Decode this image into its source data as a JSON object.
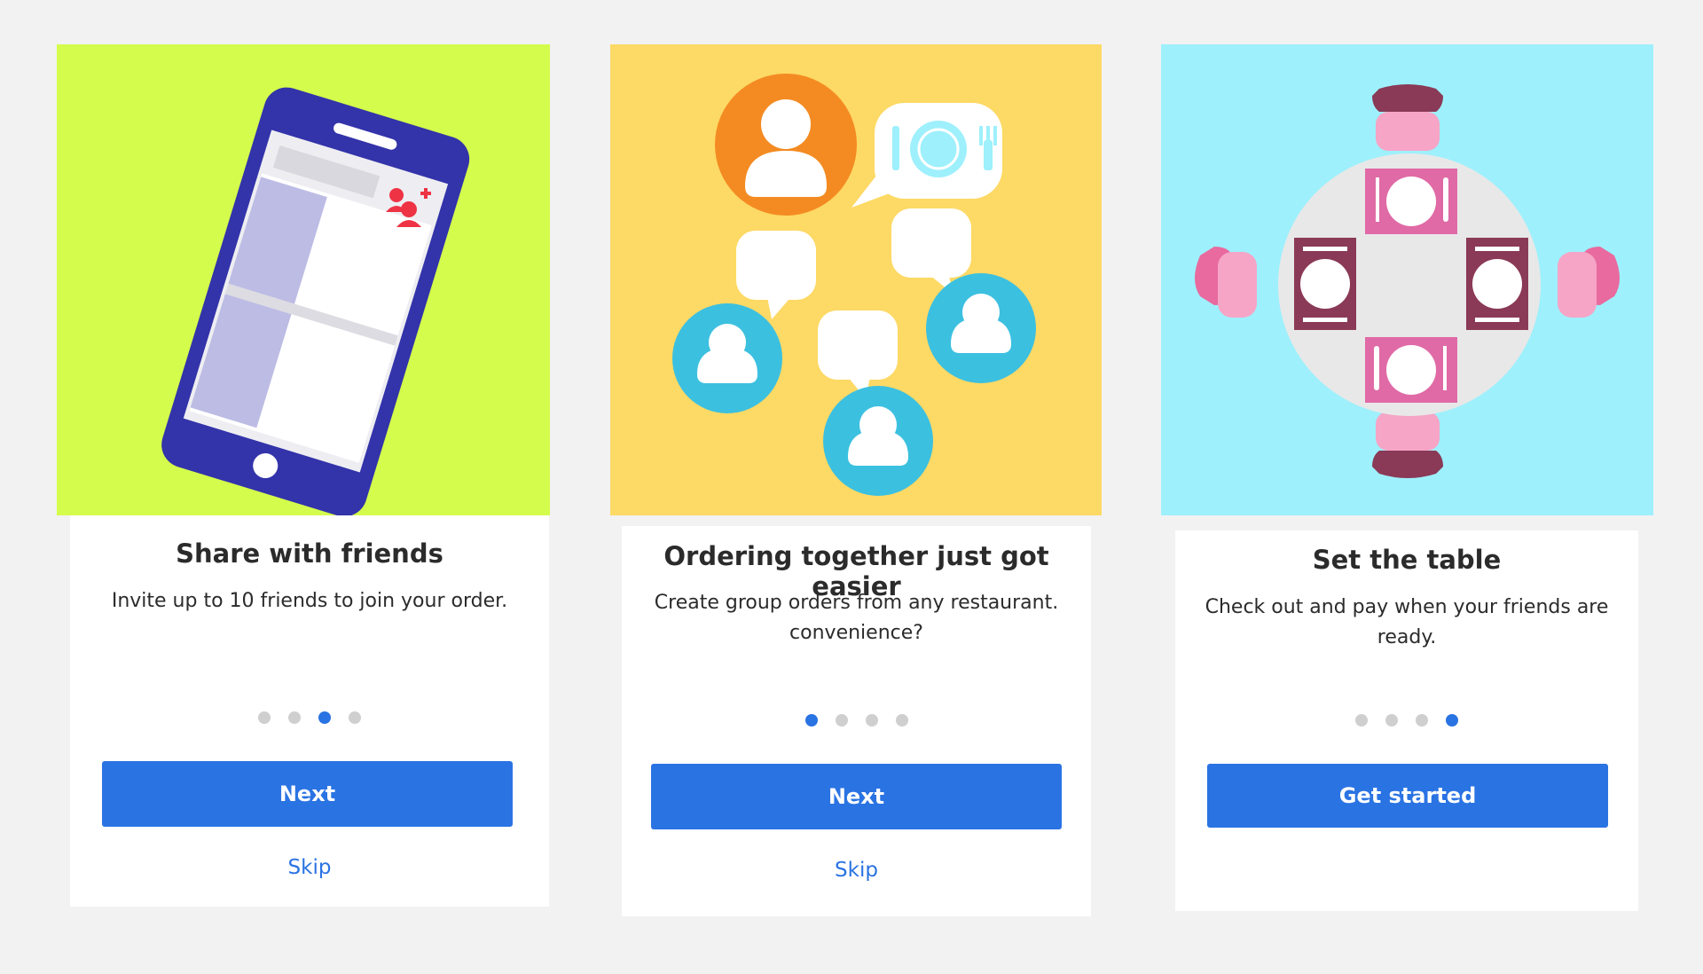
{
  "colors": {
    "page_bg": "#f2f2f2",
    "primary": "#2a73e3",
    "dot_inactive": "#cfcfcf",
    "panel_1_bg": "#d4fc4c",
    "panel_2_bg": "#fdd965",
    "panel_3_bg": "#9ef0fc"
  },
  "cards": [
    {
      "illustration": "phone-add-friends-icon",
      "title": "Share with friends",
      "body": "Invite up to 10 friends to join your order.",
      "dots_total": 4,
      "dots_active": 3,
      "button_label": "Next",
      "skip_label": "Skip"
    },
    {
      "illustration": "group-chat-icon",
      "title": "Ordering together just got easier",
      "body": "Create group orders from any restaurant. convenience?",
      "dots_total": 4,
      "dots_active": 1,
      "button_label": "Next",
      "skip_label": "Skip"
    },
    {
      "illustration": "dining-table-icon",
      "title": "Set the table",
      "body": "Check out and pay when your friends are ready.",
      "dots_total": 4,
      "dots_active": 4,
      "button_label": "Get started"
    }
  ]
}
